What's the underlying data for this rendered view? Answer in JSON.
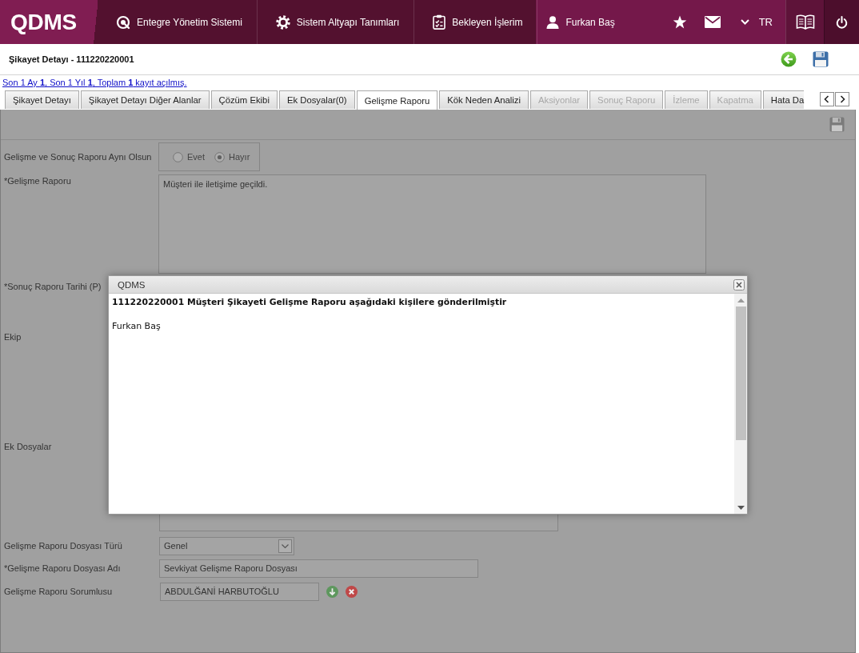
{
  "top_bar": {
    "logo": "QDMS",
    "nav": [
      {
        "label": "Entegre Yönetim Sistemi",
        "kind": "modules"
      },
      {
        "label": "Sistem Altyapı Tanımları",
        "kind": "settings"
      },
      {
        "label": "Bekleyen İşlerim",
        "kind": "tasks"
      }
    ],
    "user": "Furkan Baş",
    "language": "TR"
  },
  "header": {
    "title": "Şikayet Detayı - 111220220001"
  },
  "summary_link": "Son 1 Ay **1**, Son 1 Yıl **1**, Toplam **1** kayıt açılmış.",
  "tabs": [
    {
      "label": "Şikayet Detayı",
      "selected": false,
      "disabled": false
    },
    {
      "label": "Şikayet Detayı Diğer Alanlar",
      "selected": false,
      "disabled": false
    },
    {
      "label": "Çözüm Ekibi",
      "selected": false,
      "disabled": false
    },
    {
      "label": "Ek Dosyalar(0)",
      "selected": false,
      "disabled": false
    },
    {
      "label": "Gelişme Raporu",
      "selected": true,
      "disabled": false
    },
    {
      "label": "Kök Neden Analizi",
      "selected": false,
      "disabled": false
    },
    {
      "label": "Aksiyonlar",
      "selected": false,
      "disabled": true
    },
    {
      "label": "Sonuç Raporu",
      "selected": false,
      "disabled": true
    },
    {
      "label": "İzleme",
      "selected": false,
      "disabled": true
    },
    {
      "label": "Kapatma",
      "selected": false,
      "disabled": true
    },
    {
      "label": "Hata Da",
      "selected": false,
      "disabled": false
    }
  ],
  "form": {
    "fields": [
      {
        "kind": "radio",
        "label": "Gelişme ve Sonuç Raporu Aynı Olsun",
        "options": [
          {
            "label": "Evet",
            "selected": false
          },
          {
            "label": "Hayır",
            "selected": true
          }
        ]
      },
      {
        "kind": "textarea",
        "label": "*Gelişme Raporu",
        "value": "Müşteri ile iletişime geçildi."
      },
      {
        "kind": "date",
        "label": "*Sonuç Raporu Tarihi (P)"
      },
      {
        "kind": "team",
        "label": "Ekip"
      },
      {
        "kind": "files",
        "label": "Ek Dosyalar"
      },
      {
        "kind": "select",
        "label": "Gelişme Raporu Dosyası Türü",
        "value": "Genel"
      },
      {
        "kind": "text",
        "label": "*Gelişme Raporu Dosyası Adı",
        "value": "Sevkiyat Gelişme Raporu Dosyası"
      },
      {
        "kind": "person",
        "label": "Gelişme Raporu Sorumlusu",
        "value": "ABDULĞANİ HARBUTOĞLU"
      }
    ]
  },
  "dialog": {
    "title": "QDMS",
    "message": "111220220001 Müşteri Şikayeti Gelişme Raporu aşağıdaki kişilere gönderilmiştir",
    "recipients": [
      "Furkan Baş"
    ]
  }
}
